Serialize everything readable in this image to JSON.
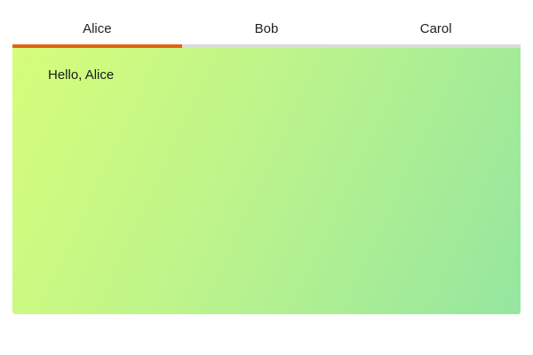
{
  "tabs": {
    "items": [
      {
        "label": "Alice",
        "active": true
      },
      {
        "label": "Bob",
        "active": false
      },
      {
        "label": "Carol",
        "active": false
      }
    ],
    "active_indicator_color": "#e2640f",
    "underline_color": "#dcdcdc"
  },
  "panel": {
    "greeting": "Hello, Alice",
    "gradient_colors": [
      "#d6fd7b",
      "#95e6a0"
    ]
  }
}
